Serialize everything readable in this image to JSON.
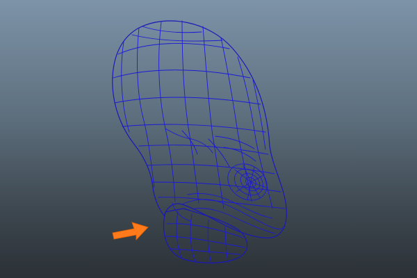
{
  "viewport": {
    "background_top": "#7d93a8",
    "background_bottom": "#2b3036",
    "mesh_fill": "#6b6b6b",
    "wireframe_color": "#1c1ad6"
  },
  "annotation": {
    "icon": "arrow-right-icon",
    "color": "#ff7a1a"
  }
}
